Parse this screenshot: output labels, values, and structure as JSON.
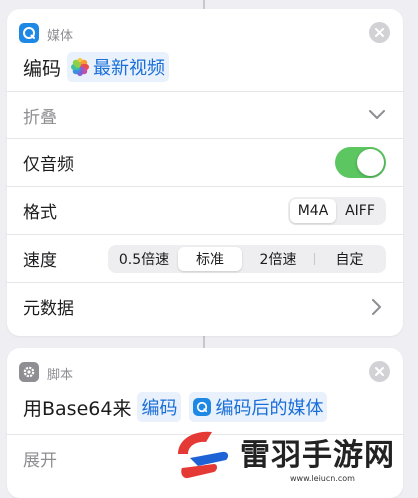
{
  "colors": {
    "accent_blue": "#1a6ed8",
    "toggle_on": "#5cc661",
    "media_icon_bg": "#1e88e5",
    "script_icon_bg": "#8e8e93"
  },
  "card1": {
    "app_icon": "media-app-icon",
    "app_name": "媒体",
    "action": "编码",
    "variable_icon": "photos-icon",
    "variable": "最新视频",
    "collapse_label": "折叠",
    "rows": {
      "audio_only_label": "仅音频",
      "audio_only_on": true,
      "format_label": "格式",
      "format_options": [
        "M4A",
        "AIFF"
      ],
      "format_selected": "M4A",
      "speed_label": "速度",
      "speed_options": [
        "0.5倍速",
        "标准",
        "2倍速",
        "自定"
      ],
      "speed_selected": "标准",
      "metadata_label": "元数据"
    }
  },
  "card2": {
    "app_icon": "gear-icon",
    "app_name": "脚本",
    "action_prefix": "用Base64来",
    "action_token": "编码",
    "variable_icon": "media-app-icon",
    "variable": "编码后的媒体",
    "expand_label": "展开"
  },
  "watermark": {
    "text": "雷羽手游网",
    "url": "www.leiucn.com"
  }
}
